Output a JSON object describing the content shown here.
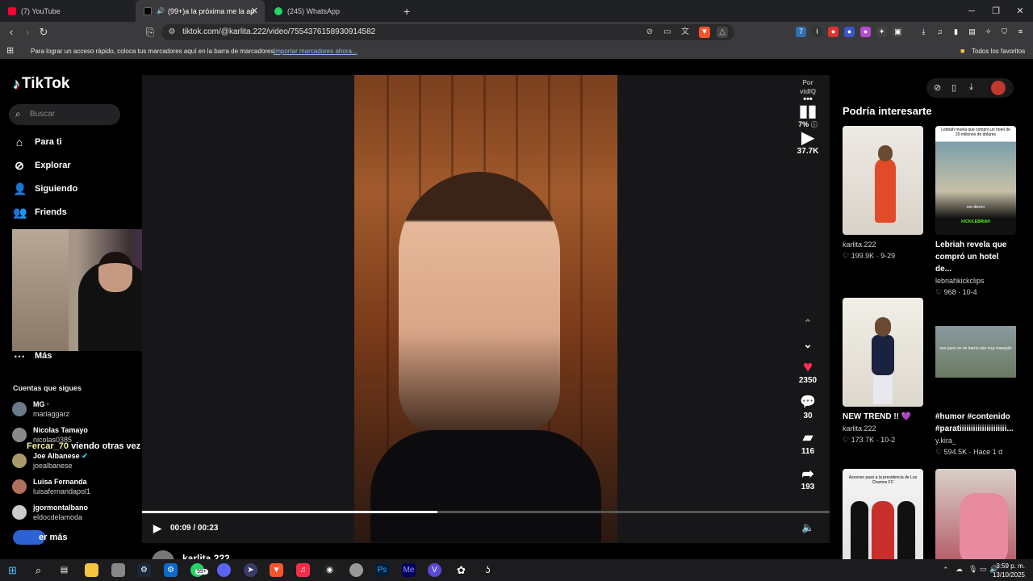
{
  "browser": {
    "tabs": [
      {
        "label": "(7) YouTube"
      },
      {
        "label": "(99+)a la próxima me la apre"
      },
      {
        "label": "(245) WhatsApp"
      }
    ],
    "url": "tiktok.com/@karlita.222/video/7554376158930914582",
    "bookmarks_hint": "Para lograr un acceso rápido, coloca tus marcadores aquí en la barra de marcadores.",
    "bookmarks_link": "Importar marcadores ahora...",
    "all_favorites": "Todos los favoritos"
  },
  "sidebar": {
    "logo": "TikTok",
    "search_placeholder": "Buscar",
    "nav": [
      {
        "label": "Para ti"
      },
      {
        "label": "Explorar"
      },
      {
        "label": "Siguiendo"
      },
      {
        "label": "Friends"
      }
    ],
    "more": "Más",
    "following_title": "Cuentas que sigues",
    "accounts": [
      {
        "name": "MG ·",
        "handle": "mariaggarz"
      },
      {
        "name": "Nicolas Tamayo",
        "handle": "nicolas0385"
      },
      {
        "name": "Joe Albanese",
        "handle": "joealbanese"
      },
      {
        "name": "Luisa Fernanda",
        "handle": "luisafernandapol1"
      },
      {
        "name": "jgormontalbano",
        "handle": "eldocdelamoda"
      }
    ],
    "see_more": "er más"
  },
  "stream_chat": {
    "user": "Fercar_70",
    "message": "viendo otras vez a esta nea"
  },
  "player": {
    "vidiq_label": "Por vidIQ",
    "vidiq_score": "7%",
    "views": "37.7K",
    "likes": "2350",
    "comments": "30",
    "saves": "116",
    "shares": "193",
    "time": "00:09 / 00:23",
    "progress": 0.43,
    "author": "karlita.222"
  },
  "recommended": {
    "title": "Podría interesarte",
    "cards": [
      {
        "title": "karlita.222",
        "author": "",
        "stats": "♡ 199.9K · 9-29",
        "bold": false
      },
      {
        "title": "Lebriah revela que",
        "title2": "compró un hotel de...",
        "author": "lebriahkickclips",
        "stats": "♡ 968 · 10-4",
        "bold": true
      },
      {
        "title": "NEW TREND !! 💜",
        "author": "karlita.222",
        "stats": "♡ 173.7K · 10-2",
        "bold": true
      },
      {
        "title": "#humor #contenido",
        "title2": "#paratiiiiiiiiiiiiiiiiiiiii...",
        "author": "y.kira_",
        "stats": "♡ 594.5K · Hace 1 d",
        "bold": true
      }
    ],
    "thumb_texts": {
      "lebriah_top": "Lebriah revela que compró un hotel de 20 millones de dólares",
      "lebriah_bottom": "me dieron",
      "kick": "KICK/LEBRIAH",
      "kira": "eso pasó en mi barrio aún muy tranquilo",
      "chamos": "Ascenso paso a la presidencia de Los Chamos FC"
    }
  },
  "taskbar": {
    "badge": "99+",
    "time": "3:59 p. m.",
    "date": "13/10/2025"
  },
  "colors": {
    "like": "#fe2c55",
    "accent": "#fe2c55"
  }
}
